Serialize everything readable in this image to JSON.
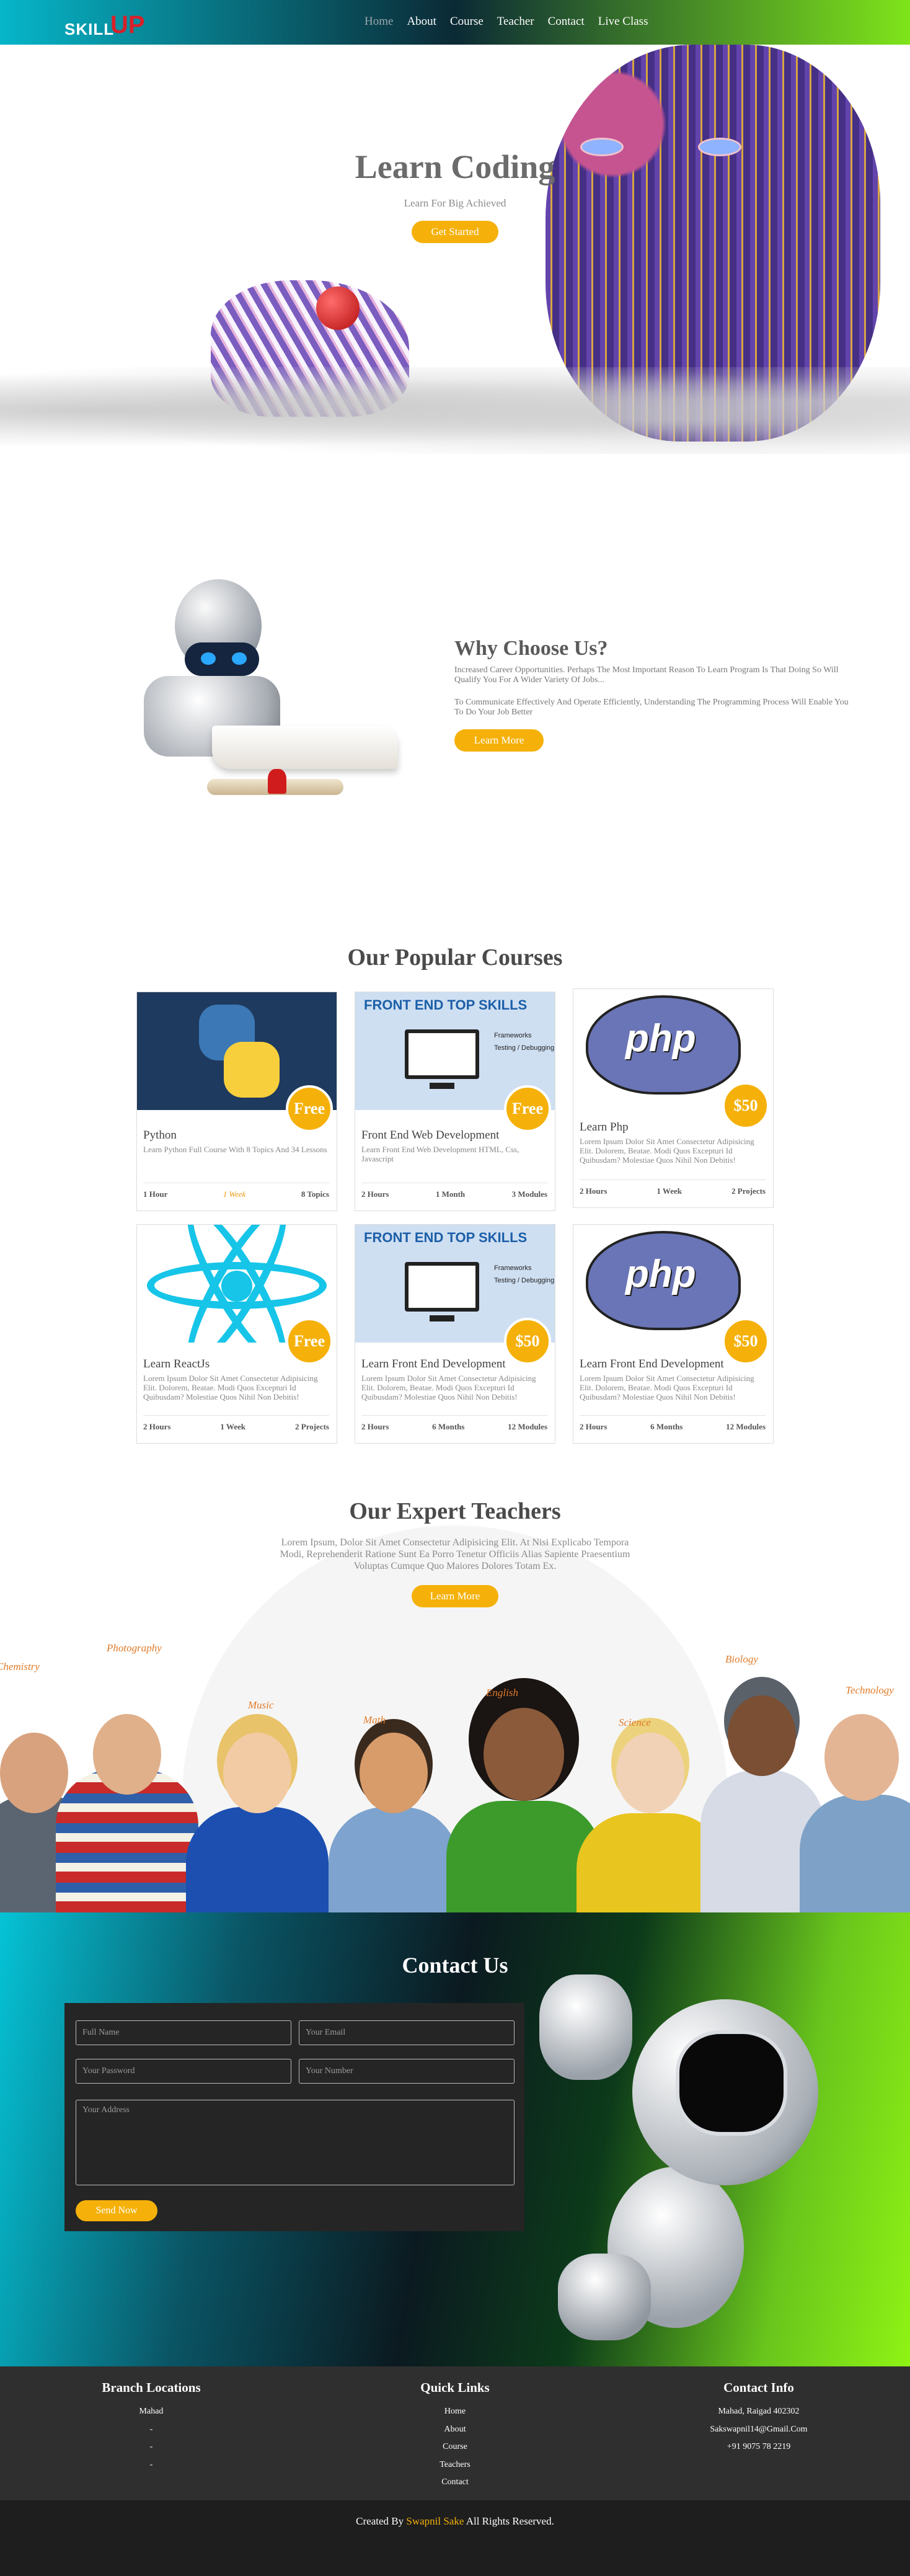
{
  "nav": {
    "logo_text": "SKILL UP",
    "logo_skill": "SKILL",
    "logo_up": "UP",
    "items": [
      {
        "label": "Home",
        "active": true
      },
      {
        "label": "About",
        "active": false
      },
      {
        "label": "Course",
        "active": false
      },
      {
        "label": "Teacher",
        "active": false
      },
      {
        "label": "Contact",
        "active": false
      },
      {
        "label": "Live Class",
        "active": false
      }
    ]
  },
  "hero": {
    "title": "Learn Coding",
    "subtitle": "Learn For Big Achieved",
    "button": "Get Started"
  },
  "why": {
    "title": "Why Choose Us?",
    "p1": "Increased Career Opportunities. Perhaps The Most Important Reason To Learn Program Is That Doing So Will Qualify You For A Wider Variety Of Jobs...",
    "p2": "To Communicate Effectively And Operate Efficiently, Understanding The Programming Process Will Enable You To Do Your Job Better",
    "button": "Learn More"
  },
  "courses": {
    "title": "Our Popular Courses",
    "cards": [
      {
        "title": "Python",
        "desc": "Learn Python Full Course With 8 Topics And 34 Lessons",
        "price": "Free",
        "meta": [
          "1 Hour",
          "1 Week",
          "8 Topics"
        ]
      },
      {
        "title": "Front End Web Development",
        "desc": "Learn Front End Web Development HTML, Css, Javascript",
        "price": "Free",
        "meta": [
          "2 Hours",
          "1 Month",
          "3 Modules"
        ]
      },
      {
        "title": "Learn Php",
        "desc": "Lorem Ipsum Dolor Sit Amet Consectetur Adipisicing Elit. Dolorem, Beatae. Modi Quos Excepturi Id Quibusdam? Molestiae Quos Nihil Non Debitis!",
        "price": "$50",
        "meta": [
          "2 Hours",
          "1 Week",
          "2 Projects"
        ]
      },
      {
        "title": "Learn ReactJs",
        "desc": "Lorem Ipsum Dolor Sit Amet Consectetur Adipisicing Elit. Dolorem, Beatae. Modi Quos Excepturi Id Quibusdam? Molestiae Quos Nihil Non Debitis!",
        "price": "Free",
        "meta": [
          "2 Hours",
          "1 Week",
          "2 Projects"
        ]
      },
      {
        "title": "Learn Front End Development",
        "desc": "Lorem Ipsum Dolor Sit Amet Consectetur Adipisicing Elit. Dolorem, Beatae. Modi Quos Excepturi Id Quibusdam? Molestiae Quos Nihil Non Debitis!",
        "price": "$50",
        "meta": [
          "2 Hours",
          "6 Months",
          "12 Modules"
        ]
      },
      {
        "title": "Learn Front End Development",
        "desc": "Lorem Ipsum Dolor Sit Amet Consectetur Adipisicing Elit. Dolorem, Beatae. Modi Quos Excepturi Id Quibusdam? Molestiae Quos Nihil Non Debitis!",
        "price": "$50",
        "meta": [
          "2 Hours",
          "6 Months",
          "12 Modules"
        ]
      }
    ],
    "fe_thumb_heading": "FRONT END TOP SKILLS",
    "fe_thumb_items": [
      "Frameworks",
      "Testing / Debugging"
    ],
    "php_thumb_text": "php"
  },
  "teachers": {
    "title": "Our Expert Teachers",
    "desc": "Lorem Ipsum, Dolor Sit Amet Consectetur Adipisicing Elit. At Nisi Explicabo Tempora Modi, Reprehenderit Ratione Sunt Ea Porro Tenetur Officiis Alias Sapiente Praesentium Voluptas Cumque Quo Maiores Dolores Totam Ex.",
    "button": "Learn More",
    "tags": [
      "Chemistry",
      "Photography",
      "Music",
      "Math",
      "English",
      "Science",
      "Biology",
      "Technology"
    ]
  },
  "contact": {
    "title": "Contact Us",
    "fields": {
      "name": "Full Name",
      "email": "Your Email",
      "password": "Your Password",
      "number": "Your Number",
      "address": "Your Address"
    },
    "button": "Send Now"
  },
  "footer": {
    "branch": {
      "title": "Branch Locations",
      "items": [
        "Mahad",
        "-",
        "-",
        "-"
      ]
    },
    "links": {
      "title": "Quick Links",
      "items": [
        "Home",
        "About",
        "Course",
        "Teachers",
        "Contact"
      ]
    },
    "info": {
      "title": "Contact Info",
      "items": [
        "Mahad, Raigad 402302",
        "Sakswapnil14@Gmail.Com",
        "+91 9075 78 2219"
      ]
    },
    "credit_prefix": "Created By",
    "credit_author": "Swapnil Sake",
    "credit_suffix": "All Rights Reserved."
  },
  "colors": {
    "accent": "#f5b10a",
    "nav_gradient": [
      "#06b6c9",
      "#0b2a35",
      "#7fe41a"
    ],
    "footer_bg": "#2f2f2f"
  },
  "icons": [
    "logo-mark",
    "python-logo",
    "php-elephant",
    "react-atom"
  ]
}
